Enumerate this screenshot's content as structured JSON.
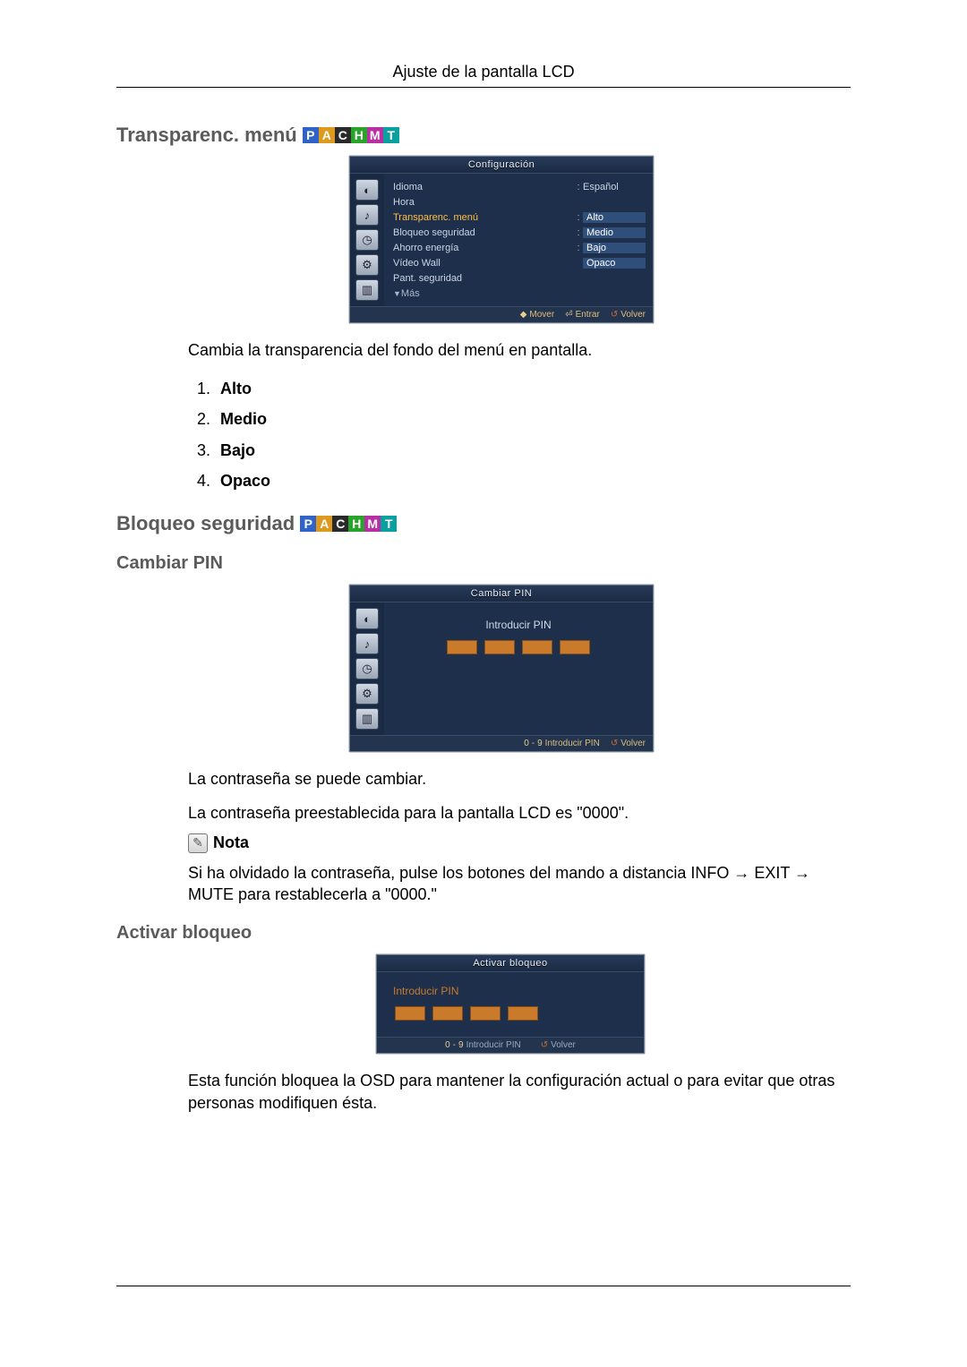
{
  "header": {
    "title": "Ajuste de la pantalla LCD"
  },
  "badges": [
    "P",
    "A",
    "C",
    "H",
    "M",
    "T"
  ],
  "section1": {
    "heading": "Transparenc. menú",
    "osd": {
      "title": "Configuración",
      "rows": [
        {
          "label": "Idioma",
          "value": "Español",
          "hl": false,
          "sel": false,
          "colon": true
        },
        {
          "label": "Hora",
          "value": "",
          "hl": false,
          "sel": false,
          "colon": false
        },
        {
          "label": "Transparenc. menú",
          "value": "Alto",
          "hl": true,
          "sel": true,
          "colon": true
        },
        {
          "label": "Bloqueo seguridad",
          "value": "Medio",
          "hl": false,
          "sel": true,
          "colon": true
        },
        {
          "label": "Ahorro energía",
          "value": "Bajo",
          "hl": false,
          "sel": true,
          "colon": true
        },
        {
          "label": "Vídeo Wall",
          "value": "Opaco",
          "hl": false,
          "sel": true,
          "colon": false
        },
        {
          "label": "Pant. seguridad",
          "value": "",
          "hl": false,
          "sel": false,
          "colon": false
        }
      ],
      "more": "Más",
      "foot": {
        "move": "Mover",
        "enter": "Entrar",
        "back": "Volver"
      }
    },
    "desc": "Cambia la transparencia del fondo del menú en pantalla.",
    "options": [
      "Alto",
      "Medio",
      "Bajo",
      "Opaco"
    ]
  },
  "section2": {
    "heading": "Bloqueo seguridad",
    "sub1": {
      "heading": "Cambiar PIN",
      "osd": {
        "title": "Cambiar PIN",
        "prompt": "Introducir PIN",
        "foot": {
          "num": "0",
          "help": "Introducir PIN",
          "back": "Volver"
        }
      },
      "p1": "La contraseña se puede cambiar.",
      "p2": "La contraseña preestablecida para la pantalla LCD es \"0000\".",
      "note_label": "Nota",
      "note_text": "Si ha olvidado la contraseña, pulse los botones del mando a distancia INFO → EXIT → MUTE para restablecerla a \"0000.\""
    },
    "sub2": {
      "heading": "Activar bloqueo",
      "osd": {
        "title": "Activar bloqueo",
        "prompt": "Introducir PIN",
        "foot": {
          "num": "0",
          "help": "Introducir PIN",
          "back": "Volver"
        }
      },
      "desc": "Esta función bloquea la OSD para mantener la configuración actual o para evitar que otras personas modifiquen ésta."
    }
  }
}
